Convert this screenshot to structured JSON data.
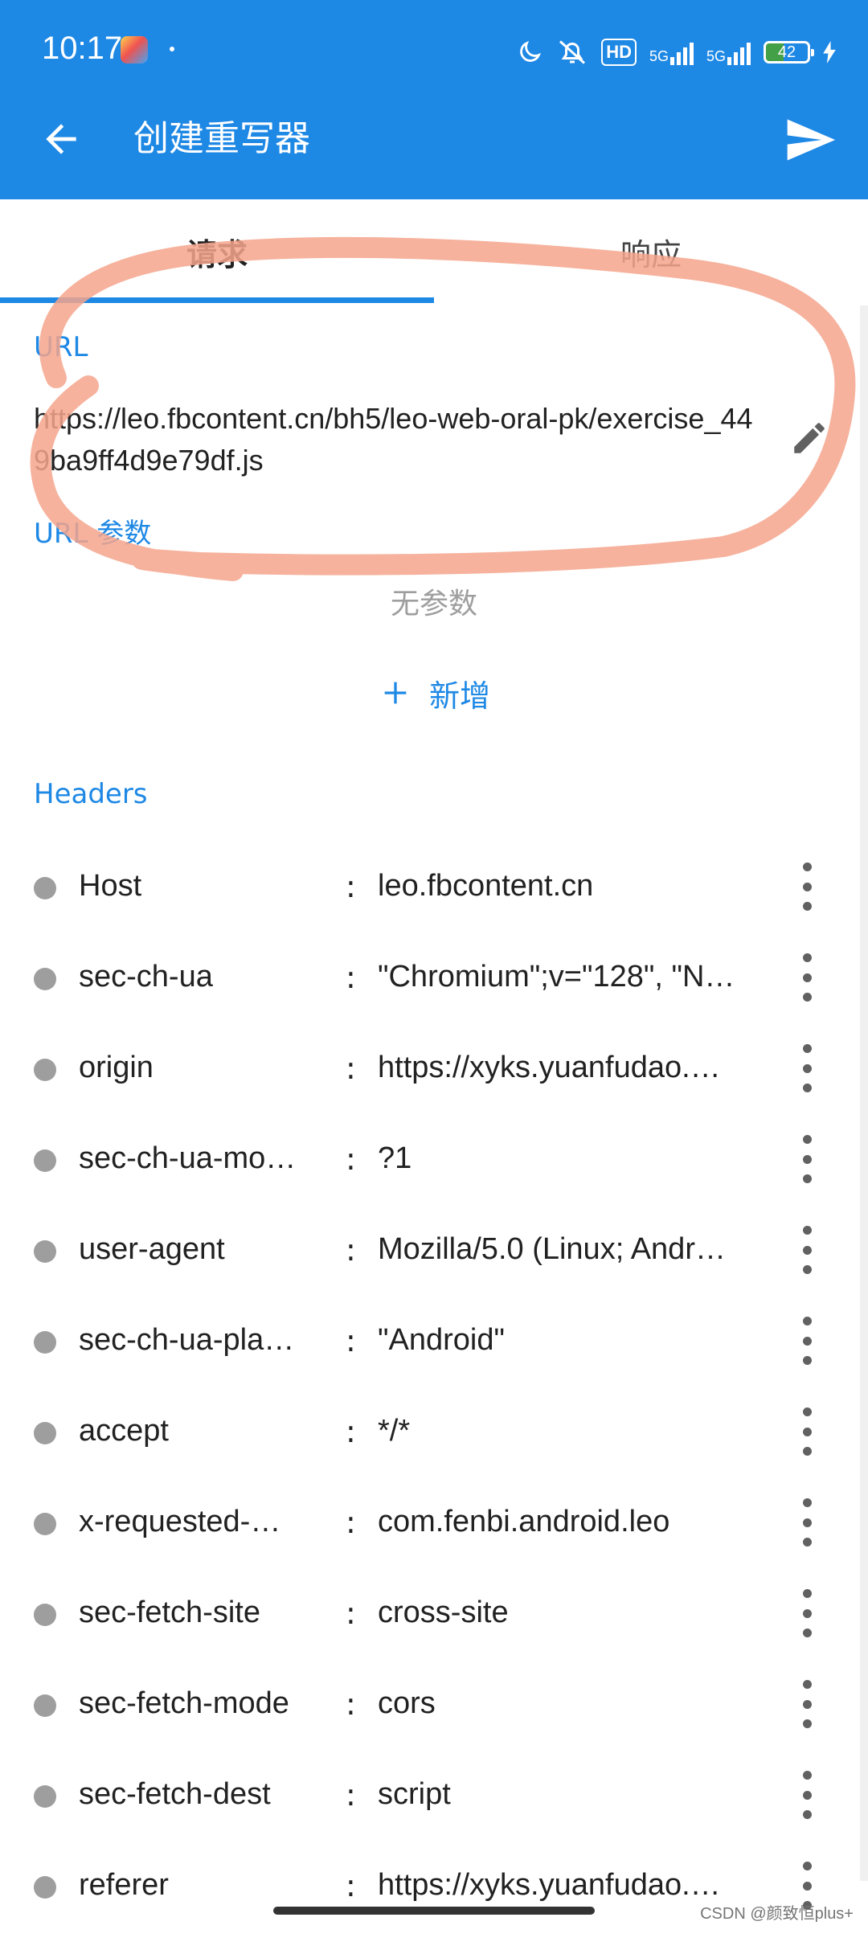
{
  "status_bar": {
    "time": "10:17",
    "hd_label": "HD",
    "network_1": "5G",
    "network_2": "5G",
    "battery_level": "42"
  },
  "app_bar": {
    "title": "创建重写器",
    "back_icon": "arrow-left-icon",
    "send_icon": "send-icon",
    "color": "#1E88E5"
  },
  "tabs": [
    {
      "label": "请求",
      "selected": true
    },
    {
      "label": "响应",
      "selected": false
    }
  ],
  "url_section": {
    "label": "URL",
    "value": "https://leo.fbcontent.cn/bh5/leo-web-oral-pk/exercise_449ba9ff4d9e79df.js",
    "edit_icon": "pencil-icon"
  },
  "url_params": {
    "label": "URL 参数",
    "empty_text": "无参数",
    "add_label": "新增"
  },
  "headers": {
    "label": "Headers",
    "separator": ":",
    "rows": [
      {
        "name": "Host",
        "value": "leo.fbcontent.cn"
      },
      {
        "name": "sec-ch-ua",
        "value": "\"Chromium\";v=\"128\", \"N…"
      },
      {
        "name": "origin",
        "value": "https://xyks.yuanfudao.…"
      },
      {
        "name": "sec-ch-ua-mo…",
        "value": "?1"
      },
      {
        "name": "user-agent",
        "value": "Mozilla/5.0 (Linux; Andr…"
      },
      {
        "name": "sec-ch-ua-pla…",
        "value": "\"Android\""
      },
      {
        "name": "accept",
        "value": "*/*"
      },
      {
        "name": "x-requested-…",
        "value": "com.fenbi.android.leo"
      },
      {
        "name": "sec-fetch-site",
        "value": "cross-site"
      },
      {
        "name": "sec-fetch-mode",
        "value": "cors"
      },
      {
        "name": "sec-fetch-dest",
        "value": "script"
      },
      {
        "name": "referer",
        "value": "https://xyks.yuanfudao.…"
      }
    ]
  },
  "watermark": "CSDN @颜致恒plus+",
  "annotation_color": "#F4A58C"
}
